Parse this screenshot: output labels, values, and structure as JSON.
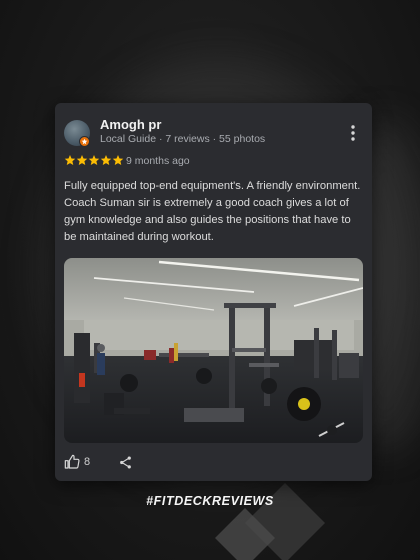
{
  "review": {
    "reviewer_name": "Amogh pr",
    "reviewer_meta": "Local Guide · 7 reviews · 55 photos",
    "rating": 5,
    "time_ago": "9 months ago",
    "text": "Fully equipped top-end equipment's. A friendly environment. Coach Suman sir is extremely a good coach gives a lot of gym knowledge and also guides the positions that have to be maintained during workout.",
    "likes": "8"
  },
  "brand": {
    "hashtag": "#FITDECKREVIEWS"
  },
  "colors": {
    "star": "#fbbc04",
    "local_guide_badge": "#e8710a",
    "card": "#2b2c30"
  },
  "icons": [
    "more-vert-icon",
    "star-icon",
    "thumbs-up-icon",
    "share-icon",
    "local-guide-badge-icon"
  ]
}
